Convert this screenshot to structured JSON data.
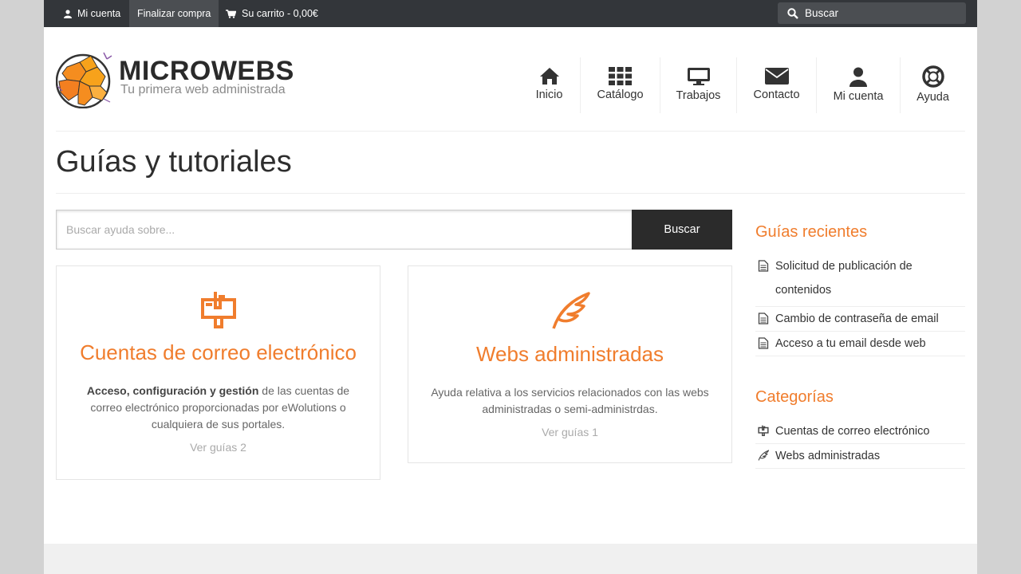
{
  "topbar": {
    "my_account": "Mi cuenta",
    "checkout": "Finalizar compra",
    "cart": "Su carrito - 0,00€",
    "search_placeholder": "Buscar"
  },
  "brand": {
    "title": "MICROWEBS",
    "subtitle": "Tu primera web administrada"
  },
  "nav": [
    {
      "label": "Inicio",
      "icon": "home-icon"
    },
    {
      "label": "Catálogo",
      "icon": "grid-icon"
    },
    {
      "label": "Trabajos",
      "icon": "desktop-icon"
    },
    {
      "label": "Contacto",
      "icon": "envelope-icon"
    },
    {
      "label": "Mi cuenta",
      "icon": "user-icon"
    },
    {
      "label": "Ayuda",
      "icon": "life-ring-icon"
    }
  ],
  "page_title": "Guías y tutoriales",
  "help_search": {
    "placeholder": "Buscar ayuda sobre...",
    "button": "Buscar"
  },
  "cards": [
    {
      "title": "Cuentas de correo electrónico",
      "desc_bold": "Acceso, configuración y gestión",
      "desc_rest": " de las cuentas de correo electrónico proporcionadas por eWolutions o cualquiera de sus portales.",
      "link": "Ver guías 2",
      "icon": "mailbox-icon"
    },
    {
      "title": "Webs administradas",
      "desc": "Ayuda relativa a los servicios relacionados con las webs administradas o semi-administrdas.",
      "link": "Ver guías 1",
      "icon": "feather-icon"
    }
  ],
  "sidebar": {
    "recent_title": "Guías recientes",
    "recent": [
      "Solicitud de publicación de contenidos",
      "Cambio de contraseña de email",
      "Acceso a tu email desde web"
    ],
    "categories_title": "Categorías",
    "categories": [
      {
        "label": "Cuentas de correo electrónico",
        "icon": "mailbox-icon"
      },
      {
        "label": "Webs administradas",
        "icon": "feather-icon"
      }
    ]
  },
  "colors": {
    "accent": "#f07d2d",
    "topbar": "#33363a",
    "dark_button": "#2b2b2b"
  }
}
